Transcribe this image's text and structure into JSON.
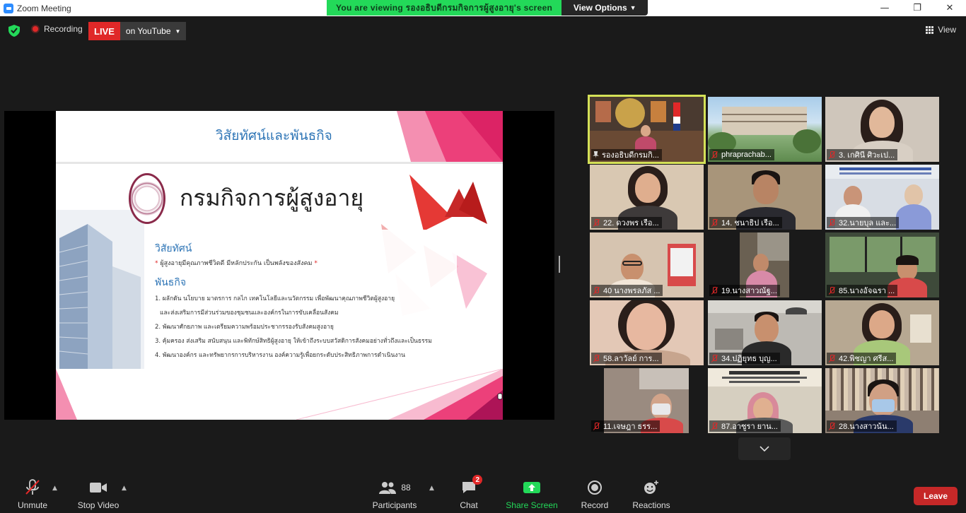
{
  "window": {
    "title": "Zoom Meeting",
    "controls": [
      "—",
      "❐",
      "✕"
    ]
  },
  "banner": {
    "prefix": "You are viewing",
    "presenter": "รองอธิบดีกรมกิจการผู้สูงอายุ",
    "suffix": "'s screen",
    "options_label": "View Options"
  },
  "top": {
    "recording_label": "Recording",
    "live_label": "LIVE",
    "stream_label": "on YouTube",
    "view_label": "View"
  },
  "slide": {
    "header": "วิสัยทัศน์และพันธกิจ",
    "main_title": "กรมกิจการผู้สูงอายุ",
    "vision_heading": "วิสัยทัศน์",
    "vision_text": "ผู้สูงอายุมีคุณภาพชีวิตดี มีหลักประกัน เป็นพลังของสังคม",
    "mission_heading": "พันธกิจ",
    "missions": [
      "1. ผลักดัน นโยบาย มาตรการ กลไก เทคโนโลยีและนวัตกรรม เพื่อพัฒนาคุณภาพชีวิตผู้สูงอายุ",
      "และส่งเสริมการมีส่วนร่วมของชุมชนและองค์กรในการขับเคลื่อนสังคม",
      "2. พัฒนาศักยภาพ และเตรียมความพร้อมประชากรรองรับสังคมสูงอายุ",
      "3. คุ้มครอง ส่งเสริม สนับสนุน และพิทักษ์สิทธิผู้สูงอายุ ให้เข้าถึงระบบสวัสดิการสังคมอย่างทั่วถึงและเป็นธรรม",
      "4. พัฒนาองค์กร และทรัพยากรการบริหารงาน องค์ความรู้เพื่อยกระดับประสิทธิภาพการดำเนินงาน"
    ]
  },
  "participants": [
    {
      "name": "รองอธิบดีกรมกิ...",
      "pinned": true,
      "muted": false,
      "active": true,
      "bg": "#4a3a30"
    },
    {
      "name": "phraprachab...",
      "pinned": false,
      "muted": true,
      "active": false,
      "bg": "#8ab07a"
    },
    {
      "name": "3. เกศินี ศิวะเป...",
      "pinned": false,
      "muted": true,
      "active": false,
      "bg": "#cfc6bb"
    },
    {
      "name": "22. ดวงพร เรือ...",
      "pinned": false,
      "muted": true,
      "active": false,
      "bg": "#d9c8b2"
    },
    {
      "name": "14. ชนาธิป เรือ...",
      "pinned": false,
      "muted": true,
      "active": false,
      "bg": "#a8957a"
    },
    {
      "name": "32.นายบุล และ...",
      "pinned": false,
      "muted": true,
      "active": false,
      "bg": "#d8dde4"
    },
    {
      "name": "40 นางพรลภัส ...",
      "pinned": false,
      "muted": true,
      "active": false,
      "bg": "#d6c4b0"
    },
    {
      "name": "19.นางสาวณัฐ...",
      "pinned": false,
      "muted": true,
      "active": false,
      "bg": "#6a6052"
    },
    {
      "name": "85.นางอัจฉรา ...",
      "pinned": false,
      "muted": true,
      "active": false,
      "bg": "#3e4a3a"
    },
    {
      "name": "58.ลาวัลย์ การ...",
      "pinned": false,
      "muted": true,
      "active": false,
      "bg": "#e3c8b6"
    },
    {
      "name": "34.ปฏิยุทธ บุญ...",
      "pinned": false,
      "muted": true,
      "active": false,
      "bg": "#bdbab4"
    },
    {
      "name": "42.พิชญา ศรีส...",
      "pinned": false,
      "muted": true,
      "active": false,
      "bg": "#b7a892"
    },
    {
      "name": "11.เจษฎา ธรร...",
      "pinned": false,
      "muted": true,
      "active": false,
      "bg": "#9a8b80"
    },
    {
      "name": "87.อาซูรา ยาน...",
      "pinned": false,
      "muted": true,
      "active": false,
      "bg": "#d6cfc0"
    },
    {
      "name": "28.นางสาวน้น...",
      "pinned": false,
      "muted": true,
      "active": false,
      "bg": "#8e7f72"
    }
  ],
  "toolbar": {
    "unmute": "Unmute",
    "stop_video": "Stop Video",
    "participants": "Participants",
    "participants_count": "88",
    "chat": "Chat",
    "chat_badge": "2",
    "share": "Share Screen",
    "record": "Record",
    "reactions": "Reactions",
    "leave": "Leave"
  },
  "colors": {
    "accent_green": "#23d959",
    "live_red": "#e02828",
    "active_tile": "#d4e157",
    "leave": "#c62828"
  }
}
